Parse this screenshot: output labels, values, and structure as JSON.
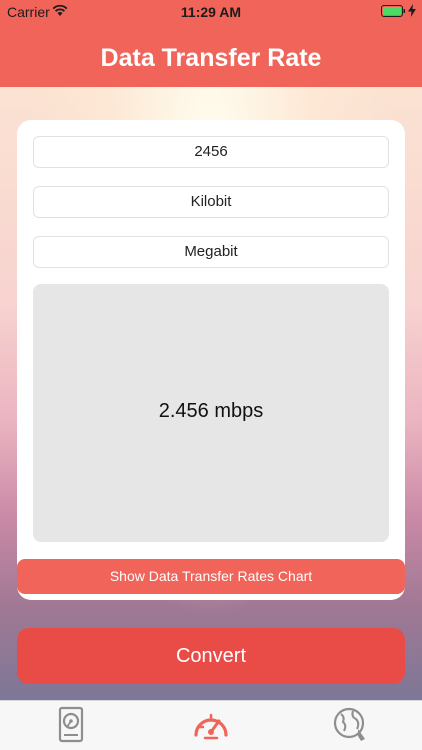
{
  "status_bar": {
    "carrier": "Carrier",
    "time": "11:29 AM"
  },
  "header": {
    "title": "Data Transfer Rate"
  },
  "form": {
    "value": "2456",
    "from_unit": "Kilobit",
    "to_unit": "Megabit",
    "result": "2.456 mbps"
  },
  "buttons": {
    "chart_label": "Show Data Transfer Rates Chart",
    "convert_label": "Convert"
  },
  "tabbar": {
    "tabs": [
      {
        "icon": "hard-drive-icon",
        "active": false
      },
      {
        "icon": "speedometer-icon",
        "active": true
      },
      {
        "icon": "globe-icon",
        "active": false
      }
    ]
  },
  "colors": {
    "accent": "#f0645a",
    "convert": "#e94b47",
    "inactive_tab": "#8e8e8e"
  }
}
